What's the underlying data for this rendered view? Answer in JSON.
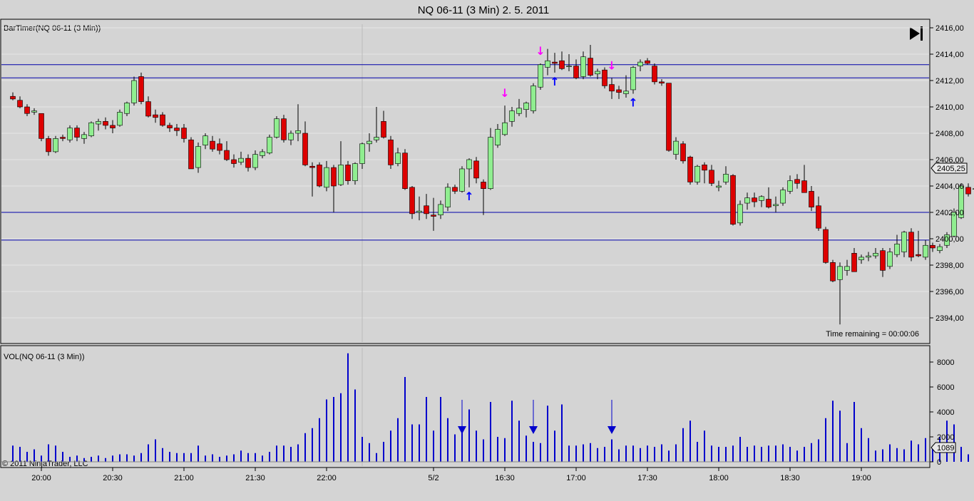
{
  "window": {
    "title": "NQ 06-11 (3 Min)  2. 5. 2011"
  },
  "price_panel": {
    "label": "BarTimer(NQ 06-11 (3 Min))",
    "time_remaining": "Time remaining = 00:00:06",
    "last_price_label": "2405,25",
    "y_ticks": [
      "2394,00",
      "2396,00",
      "2398,00",
      "2400,00",
      "2402,00",
      "2404,00",
      "2406,00",
      "2408,00",
      "2410,00",
      "2412,00",
      "2414,00",
      "2416,00"
    ],
    "horizontal_lines": [
      2413.2,
      2412.2,
      2402.0,
      2399.9
    ]
  },
  "volume_panel": {
    "label": "VOL(NQ 06-11 (3 Min))",
    "y_ticks": [
      "0",
      "2000",
      "4000",
      "6000",
      "8000"
    ],
    "last_volume_label": "1089"
  },
  "x_ticks": [
    "20:00",
    "20:30",
    "21:00",
    "21:30",
    "22:00",
    "5/2",
    "16:30",
    "17:00",
    "17:30",
    "18:00",
    "18:30",
    "19:00"
  ],
  "copyright": "© 2011 NinjaTrader, LLC",
  "colors": {
    "background": "#d4d4d4",
    "up_candle": "#90ee90",
    "down_candle": "#dd0000",
    "volume_bar": "#0000cc",
    "level_line": "#0000aa",
    "entry_arrow": "#0000ff",
    "exit_arrow": "#ff00ff"
  },
  "chart_data": [
    {
      "type": "candlestick",
      "title": "NQ 06-11 (3 Min)  2. 5. 2011",
      "y_range": [
        2392.9,
        2416.5
      ],
      "candles": [
        {
          "o": 2410.8,
          "h": 2411.1,
          "l": 2410.5,
          "c": 2410.6
        },
        {
          "o": 2410.5,
          "h": 2410.8,
          "l": 2409.9,
          "c": 2410.0
        },
        {
          "o": 2410.0,
          "h": 2410.2,
          "l": 2409.3,
          "c": 2409.5
        },
        {
          "o": 2409.6,
          "h": 2409.9,
          "l": 2409.4,
          "c": 2409.7
        },
        {
          "o": 2409.5,
          "h": 2409.5,
          "l": 2407.4,
          "c": 2407.6
        },
        {
          "o": 2407.6,
          "h": 2407.8,
          "l": 2406.3,
          "c": 2406.6
        },
        {
          "o": 2406.6,
          "h": 2407.8,
          "l": 2406.5,
          "c": 2407.6
        },
        {
          "o": 2407.7,
          "h": 2407.9,
          "l": 2407.4,
          "c": 2407.6
        },
        {
          "o": 2407.5,
          "h": 2408.6,
          "l": 2407.3,
          "c": 2408.4
        },
        {
          "o": 2408.4,
          "h": 2408.6,
          "l": 2407.4,
          "c": 2407.7
        },
        {
          "o": 2407.6,
          "h": 2408.1,
          "l": 2407.2,
          "c": 2407.9
        },
        {
          "o": 2407.8,
          "h": 2408.9,
          "l": 2407.7,
          "c": 2408.8
        },
        {
          "o": 2408.7,
          "h": 2409.1,
          "l": 2408.2,
          "c": 2408.9
        },
        {
          "o": 2408.9,
          "h": 2409.2,
          "l": 2408.3,
          "c": 2408.6
        },
        {
          "o": 2408.6,
          "h": 2409.0,
          "l": 2408.0,
          "c": 2408.4
        },
        {
          "o": 2408.6,
          "h": 2409.8,
          "l": 2408.5,
          "c": 2409.6
        },
        {
          "o": 2409.5,
          "h": 2410.4,
          "l": 2409.3,
          "c": 2410.3
        },
        {
          "o": 2410.3,
          "h": 2412.3,
          "l": 2410.1,
          "c": 2412.0
        },
        {
          "o": 2412.3,
          "h": 2412.6,
          "l": 2410.2,
          "c": 2410.4
        },
        {
          "o": 2410.4,
          "h": 2410.8,
          "l": 2409.2,
          "c": 2409.3
        },
        {
          "o": 2409.4,
          "h": 2409.8,
          "l": 2408.8,
          "c": 2409.2
        },
        {
          "o": 2409.4,
          "h": 2409.6,
          "l": 2408.5,
          "c": 2408.6
        },
        {
          "o": 2408.6,
          "h": 2408.8,
          "l": 2408.1,
          "c": 2408.4
        },
        {
          "o": 2408.4,
          "h": 2408.7,
          "l": 2407.8,
          "c": 2408.2
        },
        {
          "o": 2408.4,
          "h": 2408.7,
          "l": 2407.3,
          "c": 2407.6
        },
        {
          "o": 2407.5,
          "h": 2407.7,
          "l": 2405.3,
          "c": 2405.3
        },
        {
          "o": 2405.4,
          "h": 2407.3,
          "l": 2405.0,
          "c": 2407.0
        },
        {
          "o": 2407.1,
          "h": 2408.0,
          "l": 2406.8,
          "c": 2407.8
        },
        {
          "o": 2407.4,
          "h": 2407.8,
          "l": 2406.6,
          "c": 2406.8
        },
        {
          "o": 2407.2,
          "h": 2407.6,
          "l": 2406.4,
          "c": 2406.7
        },
        {
          "o": 2406.7,
          "h": 2407.4,
          "l": 2405.9,
          "c": 2406.0
        },
        {
          "o": 2406.0,
          "h": 2406.4,
          "l": 2405.4,
          "c": 2405.7
        },
        {
          "o": 2405.8,
          "h": 2406.6,
          "l": 2405.6,
          "c": 2406.1
        },
        {
          "o": 2406.1,
          "h": 2406.4,
          "l": 2405.1,
          "c": 2405.4
        },
        {
          "o": 2405.4,
          "h": 2406.7,
          "l": 2405.2,
          "c": 2406.4
        },
        {
          "o": 2406.3,
          "h": 2406.8,
          "l": 2406.1,
          "c": 2406.6
        },
        {
          "o": 2406.5,
          "h": 2407.9,
          "l": 2406.4,
          "c": 2407.7
        },
        {
          "o": 2407.7,
          "h": 2409.3,
          "l": 2407.6,
          "c": 2409.1
        },
        {
          "o": 2409.1,
          "h": 2409.4,
          "l": 2407.3,
          "c": 2407.5
        },
        {
          "o": 2407.5,
          "h": 2408.2,
          "l": 2407.1,
          "c": 2408.0
        },
        {
          "o": 2408.0,
          "h": 2410.2,
          "l": 2407.4,
          "c": 2408.2
        },
        {
          "o": 2408.0,
          "h": 2408.9,
          "l": 2405.5,
          "c": 2405.6
        },
        {
          "o": 2405.5,
          "h": 2405.8,
          "l": 2403.2,
          "c": 2405.4
        },
        {
          "o": 2405.6,
          "h": 2405.8,
          "l": 2403.9,
          "c": 2404.0
        },
        {
          "o": 2403.9,
          "h": 2405.9,
          "l": 2403.6,
          "c": 2405.4
        },
        {
          "o": 2405.4,
          "h": 2405.6,
          "l": 2402.0,
          "c": 2404.0
        },
        {
          "o": 2404.1,
          "h": 2407.4,
          "l": 2404.0,
          "c": 2405.6
        },
        {
          "o": 2405.6,
          "h": 2405.9,
          "l": 2404.1,
          "c": 2404.4
        },
        {
          "o": 2404.4,
          "h": 2405.8,
          "l": 2404.1,
          "c": 2405.7
        },
        {
          "o": 2405.7,
          "h": 2407.3,
          "l": 2405.3,
          "c": 2407.2
        },
        {
          "o": 2407.2,
          "h": 2408.0,
          "l": 2406.6,
          "c": 2407.4
        },
        {
          "o": 2407.5,
          "h": 2410.0,
          "l": 2407.3,
          "c": 2407.7
        },
        {
          "o": 2408.9,
          "h": 2409.7,
          "l": 2407.6,
          "c": 2407.7
        },
        {
          "o": 2407.5,
          "h": 2407.8,
          "l": 2405.3,
          "c": 2405.6
        },
        {
          "o": 2405.7,
          "h": 2406.9,
          "l": 2405.5,
          "c": 2406.5
        },
        {
          "o": 2406.5,
          "h": 2406.8,
          "l": 2403.7,
          "c": 2403.8
        },
        {
          "o": 2403.9,
          "h": 2404.0,
          "l": 2401.5,
          "c": 2401.9
        },
        {
          "o": 2402.0,
          "h": 2403.2,
          "l": 2401.4,
          "c": 2402.1
        },
        {
          "o": 2402.5,
          "h": 2403.4,
          "l": 2401.5,
          "c": 2401.9
        },
        {
          "o": 2401.8,
          "h": 2403.1,
          "l": 2400.6,
          "c": 2401.7
        },
        {
          "o": 2401.8,
          "h": 2402.9,
          "l": 2401.5,
          "c": 2402.6
        },
        {
          "o": 2402.4,
          "h": 2404.2,
          "l": 2402.1,
          "c": 2403.9
        },
        {
          "o": 2403.9,
          "h": 2404.1,
          "l": 2403.4,
          "c": 2403.6
        },
        {
          "o": 2403.6,
          "h": 2405.5,
          "l": 2403.5,
          "c": 2405.3
        },
        {
          "o": 2405.3,
          "h": 2406.1,
          "l": 2403.9,
          "c": 2406.0
        },
        {
          "o": 2405.9,
          "h": 2406.2,
          "l": 2404.2,
          "c": 2404.6
        },
        {
          "o": 2404.3,
          "h": 2404.5,
          "l": 2401.8,
          "c": 2403.8
        },
        {
          "o": 2403.8,
          "h": 2408.4,
          "l": 2403.7,
          "c": 2407.7
        },
        {
          "o": 2407.1,
          "h": 2408.7,
          "l": 2406.9,
          "c": 2408.3
        },
        {
          "o": 2407.9,
          "h": 2410.1,
          "l": 2407.8,
          "c": 2408.8
        },
        {
          "o": 2408.9,
          "h": 2410.0,
          "l": 2408.5,
          "c": 2409.7
        },
        {
          "o": 2409.5,
          "h": 2410.6,
          "l": 2409.3,
          "c": 2409.9
        },
        {
          "o": 2409.8,
          "h": 2410.4,
          "l": 2409.2,
          "c": 2410.3
        },
        {
          "o": 2409.7,
          "h": 2411.8,
          "l": 2409.5,
          "c": 2411.6
        },
        {
          "o": 2411.5,
          "h": 2413.3,
          "l": 2411.3,
          "c": 2413.2
        },
        {
          "o": 2413.0,
          "h": 2414.4,
          "l": 2412.4,
          "c": 2413.5
        },
        {
          "o": 2413.4,
          "h": 2414.1,
          "l": 2412.6,
          "c": 2413.3
        },
        {
          "o": 2413.5,
          "h": 2414.2,
          "l": 2412.8,
          "c": 2412.9
        },
        {
          "o": 2413.1,
          "h": 2414.0,
          "l": 2412.7,
          "c": 2413.1
        },
        {
          "o": 2413.1,
          "h": 2413.6,
          "l": 2412.1,
          "c": 2412.2
        },
        {
          "o": 2412.3,
          "h": 2414.2,
          "l": 2412.1,
          "c": 2413.8
        },
        {
          "o": 2413.7,
          "h": 2414.7,
          "l": 2412.3,
          "c": 2412.4
        },
        {
          "o": 2412.5,
          "h": 2412.9,
          "l": 2412.1,
          "c": 2412.7
        },
        {
          "o": 2412.8,
          "h": 2413.0,
          "l": 2411.4,
          "c": 2411.6
        },
        {
          "o": 2411.7,
          "h": 2412.2,
          "l": 2410.6,
          "c": 2411.2
        },
        {
          "o": 2411.3,
          "h": 2411.6,
          "l": 2410.6,
          "c": 2411.1
        },
        {
          "o": 2411.0,
          "h": 2412.4,
          "l": 2410.7,
          "c": 2411.2
        },
        {
          "o": 2411.3,
          "h": 2413.1,
          "l": 2411.0,
          "c": 2413.0
        },
        {
          "o": 2413.1,
          "h": 2413.6,
          "l": 2412.7,
          "c": 2413.4
        },
        {
          "o": 2413.5,
          "h": 2413.7,
          "l": 2413.2,
          "c": 2413.3
        },
        {
          "o": 2413.1,
          "h": 2413.3,
          "l": 2411.7,
          "c": 2411.9
        },
        {
          "o": 2411.9,
          "h": 2412.1,
          "l": 2411.6,
          "c": 2411.8
        },
        {
          "o": 2411.8,
          "h": 2411.8,
          "l": 2406.6,
          "c": 2406.7
        },
        {
          "o": 2406.4,
          "h": 2407.7,
          "l": 2406.0,
          "c": 2407.4
        },
        {
          "o": 2407.2,
          "h": 2407.4,
          "l": 2405.7,
          "c": 2405.9
        },
        {
          "o": 2406.2,
          "h": 2406.3,
          "l": 2404.1,
          "c": 2404.3
        },
        {
          "o": 2404.3,
          "h": 2405.6,
          "l": 2404.1,
          "c": 2405.5
        },
        {
          "o": 2405.6,
          "h": 2405.8,
          "l": 2404.2,
          "c": 2405.2
        },
        {
          "o": 2405.2,
          "h": 2405.6,
          "l": 2404.0,
          "c": 2404.2
        },
        {
          "o": 2403.9,
          "h": 2404.4,
          "l": 2403.6,
          "c": 2404.0
        },
        {
          "o": 2404.3,
          "h": 2405.5,
          "l": 2404.1,
          "c": 2404.9
        },
        {
          "o": 2404.8,
          "h": 2404.9,
          "l": 2401.0,
          "c": 2401.1
        },
        {
          "o": 2401.2,
          "h": 2402.9,
          "l": 2401.0,
          "c": 2402.6
        },
        {
          "o": 2402.7,
          "h": 2403.5,
          "l": 2402.2,
          "c": 2403.1
        },
        {
          "o": 2403.1,
          "h": 2403.5,
          "l": 2402.4,
          "c": 2402.8
        },
        {
          "o": 2402.9,
          "h": 2403.3,
          "l": 2402.4,
          "c": 2403.2
        },
        {
          "o": 2403.0,
          "h": 2403.9,
          "l": 2402.3,
          "c": 2402.4
        },
        {
          "o": 2402.5,
          "h": 2403.2,
          "l": 2402.0,
          "c": 2402.6
        },
        {
          "o": 2402.7,
          "h": 2403.9,
          "l": 2402.5,
          "c": 2403.7
        },
        {
          "o": 2403.6,
          "h": 2404.8,
          "l": 2403.4,
          "c": 2404.4
        },
        {
          "o": 2404.5,
          "h": 2404.9,
          "l": 2403.8,
          "c": 2404.2
        },
        {
          "o": 2404.4,
          "h": 2405.6,
          "l": 2403.6,
          "c": 2403.5
        },
        {
          "o": 2403.6,
          "h": 2404.0,
          "l": 2402.1,
          "c": 2402.4
        },
        {
          "o": 2402.5,
          "h": 2403.2,
          "l": 2400.6,
          "c": 2400.8
        },
        {
          "o": 2400.7,
          "h": 2400.9,
          "l": 2398.1,
          "c": 2398.2
        },
        {
          "o": 2398.2,
          "h": 2398.4,
          "l": 2396.7,
          "c": 2396.8
        },
        {
          "o": 2396.9,
          "h": 2398.2,
          "l": 2393.5,
          "c": 2397.9
        },
        {
          "o": 2397.6,
          "h": 2398.4,
          "l": 2397.2,
          "c": 2397.9
        },
        {
          "o": 2398.9,
          "h": 2399.3,
          "l": 2397.5,
          "c": 2397.5
        },
        {
          "o": 2398.4,
          "h": 2398.8,
          "l": 2398.1,
          "c": 2398.6
        },
        {
          "o": 2398.6,
          "h": 2399.0,
          "l": 2398.3,
          "c": 2398.7
        },
        {
          "o": 2398.7,
          "h": 2399.3,
          "l": 2398.5,
          "c": 2398.9
        },
        {
          "o": 2399.1,
          "h": 2399.3,
          "l": 2397.1,
          "c": 2397.6
        },
        {
          "o": 2397.9,
          "h": 2399.3,
          "l": 2397.7,
          "c": 2399.0
        },
        {
          "o": 2398.8,
          "h": 2400.3,
          "l": 2398.6,
          "c": 2399.6
        },
        {
          "o": 2399.0,
          "h": 2400.6,
          "l": 2398.6,
          "c": 2400.5
        },
        {
          "o": 2400.5,
          "h": 2400.8,
          "l": 2398.3,
          "c": 2398.6
        },
        {
          "o": 2398.8,
          "h": 2400.6,
          "l": 2398.6,
          "c": 2398.7
        },
        {
          "o": 2398.6,
          "h": 2399.9,
          "l": 2398.4,
          "c": 2399.5
        },
        {
          "o": 2399.5,
          "h": 2399.7,
          "l": 2399.0,
          "c": 2399.3
        },
        {
          "o": 2399.1,
          "h": 2399.6,
          "l": 2398.9,
          "c": 2399.4
        },
        {
          "o": 2399.5,
          "h": 2400.5,
          "l": 2399.3,
          "c": 2400.3
        },
        {
          "o": 2400.2,
          "h": 2402.3,
          "l": 2400.1,
          "c": 2402.0
        },
        {
          "o": 2401.6,
          "h": 2404.2,
          "l": 2401.5,
          "c": 2404.0
        },
        {
          "o": 2403.9,
          "h": 2404.2,
          "l": 2403.2,
          "c": 2403.4
        },
        {
          "o": 2403.8,
          "h": 2404.4,
          "l": 2402.9,
          "c": 2403.8
        },
        {
          "o": 2403.4,
          "h": 2405.4,
          "l": 2402.9,
          "c": 2405.2
        }
      ],
      "volume": [
        1300,
        1200,
        800,
        1000,
        500,
        1400,
        1300,
        800,
        400,
        500,
        300,
        400,
        500,
        300,
        500,
        600,
        600,
        500,
        700,
        1400,
        1800,
        1100,
        800,
        700,
        700,
        700,
        1300,
        500,
        600,
        400,
        500,
        600,
        900,
        700,
        700,
        500,
        800,
        1300,
        1300,
        1200,
        1400,
        2300,
        2700,
        3500,
        5000,
        5200,
        5500,
        8700,
        5800,
        2000,
        1500,
        700,
        1600,
        2500,
        3500,
        6800,
        3000,
        3000,
        5200,
        2500,
        5200,
        3500,
        2200,
        2800,
        4200,
        2500,
        1800,
        4800,
        2000,
        1900,
        4900,
        3300,
        2100,
        1600,
        1500,
        4500,
        2500,
        4600,
        1300,
        1300,
        1400,
        1500,
        1100,
        1200,
        1800,
        1000,
        1300,
        1300,
        1100,
        1300,
        1200,
        1400,
        900,
        1400,
        2700,
        3300,
        1600,
        2500,
        1300,
        1200,
        1200,
        1300,
        2000,
        1200,
        1300,
        1200,
        1300,
        1300,
        1400,
        1200,
        900,
        1200,
        1500,
        1800,
        3500,
        4900,
        4100,
        1500,
        4800,
        2700,
        1900,
        900,
        1000,
        1400,
        1100,
        1000,
        1700,
        1400,
        1900,
        1200,
        2000,
        3300,
        3000,
        1200,
        600,
        2300,
        2500,
        1000,
        900,
        1400,
        1089
      ],
      "x_tick_labels": [
        "20:00",
        "20:30",
        "21:00",
        "21:30",
        "22:00",
        "5/2",
        "16:30",
        "17:00",
        "17:30",
        "18:00",
        "18:30",
        "19:00"
      ],
      "x_tick_bar_index": [
        4,
        14,
        24,
        34,
        44,
        59,
        69,
        79,
        89,
        99,
        109,
        119
      ],
      "signals": [
        {
          "bar": 64,
          "type": "long_entry",
          "label": "↑"
        },
        {
          "bar": 69,
          "type": "short_exit",
          "label": "↓"
        },
        {
          "bar": 74,
          "type": "short_entry",
          "label": "↓"
        },
        {
          "bar": 76,
          "type": "long_entry",
          "label": "↑"
        },
        {
          "bar": 84,
          "type": "short_entry",
          "label": "↓"
        },
        {
          "bar": 87,
          "type": "long_entry",
          "label": "↑"
        }
      ],
      "volume_markers": [
        63,
        73,
        84
      ]
    }
  ]
}
